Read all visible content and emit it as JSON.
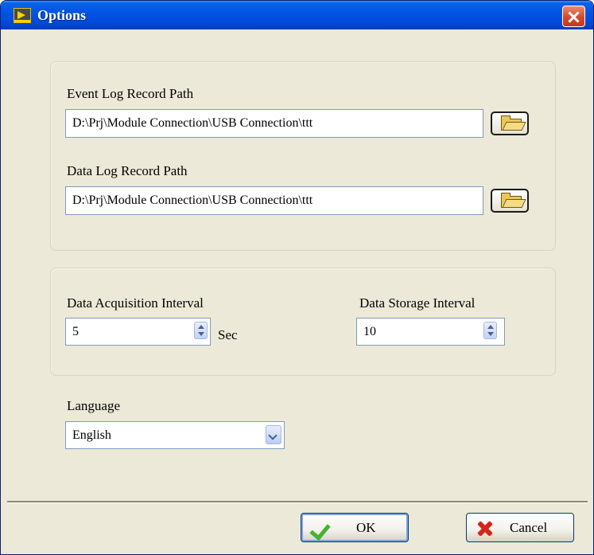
{
  "window": {
    "title": "Options"
  },
  "paths": {
    "event_label": "Event Log Record Path",
    "event_value": "D:\\Prj\\Module Connection\\USB Connection\\ttt",
    "data_label": "Data Log Record Path",
    "data_value": "D:\\Prj\\Module Connection\\USB Connection\\ttt"
  },
  "intervals": {
    "acquisition_label": "Data Acquisition Interval",
    "acquisition_value": "5",
    "acquisition_unit": "Sec",
    "storage_label": "Data Storage Interval",
    "storage_value": "10"
  },
  "language": {
    "label": "Language",
    "selected": "English"
  },
  "footer": {
    "ok_label": "OK",
    "cancel_label": "Cancel"
  },
  "icons": [
    "labview-app-icon",
    "close-icon",
    "folder-open-icon",
    "spinner-arrows-icon",
    "chevron-down-icon",
    "check-icon",
    "red-x-icon"
  ]
}
